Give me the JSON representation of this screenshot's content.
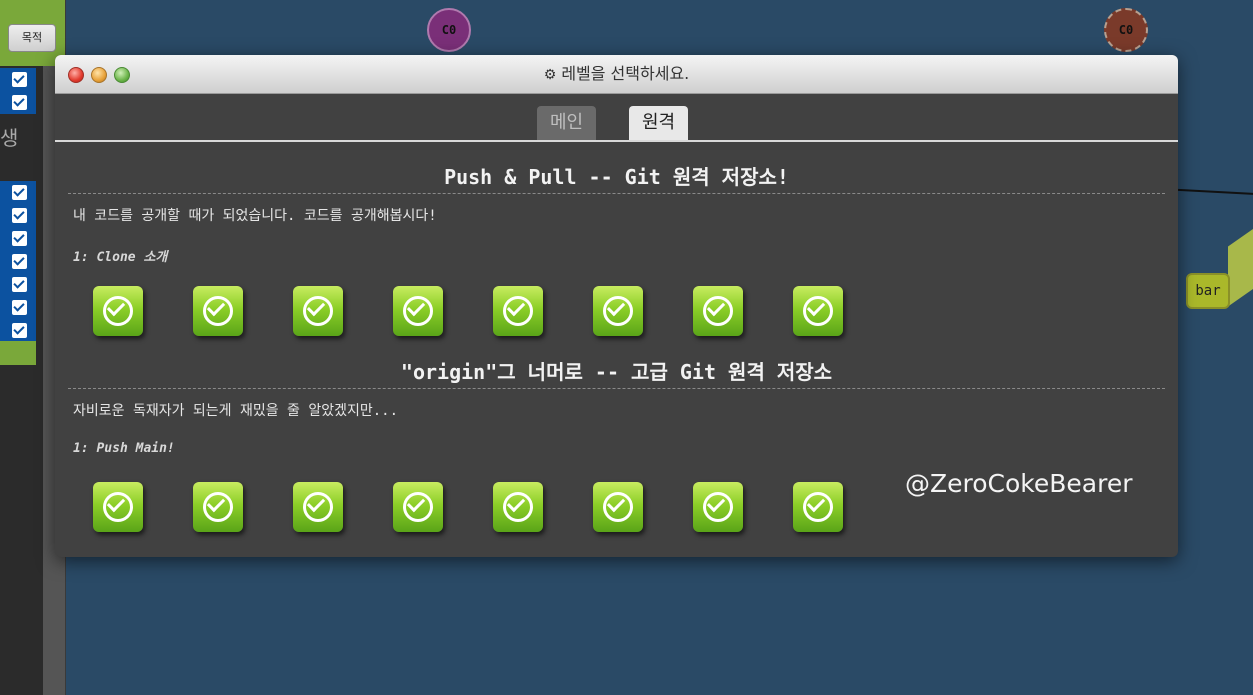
{
  "background": {
    "left_panel": {
      "goal_button": "목적",
      "partial_label": "생"
    },
    "graph_nodes": [
      "C0",
      "C0"
    ],
    "branch_label": "bar"
  },
  "modal": {
    "title": "레벨을 선택하세요.",
    "tabs": [
      {
        "label": "메인",
        "selected": false
      },
      {
        "label": "원격",
        "selected": true
      }
    ],
    "sections": [
      {
        "title": "Push & Pull -- Git 원격 저장소!",
        "description": "내 코드를 공개할 때가 되었습니다. 코드를 공개해봅시다!",
        "selected_level": "1: Clone 소개",
        "levels": 8
      },
      {
        "title": "\"origin\"그 너머로 -- 고급 Git 원격 저장소",
        "description": "자비로운 독재자가 되는게 재밌을 줄 알았겠지만...",
        "selected_level": "1: Push Main!",
        "levels": 8
      }
    ],
    "watermark": "@ZeroCokeBearer"
  },
  "colors": {
    "modal_bg": "#414141",
    "level_complete": "#8ccf28",
    "page_bg": "#2a4a66"
  }
}
